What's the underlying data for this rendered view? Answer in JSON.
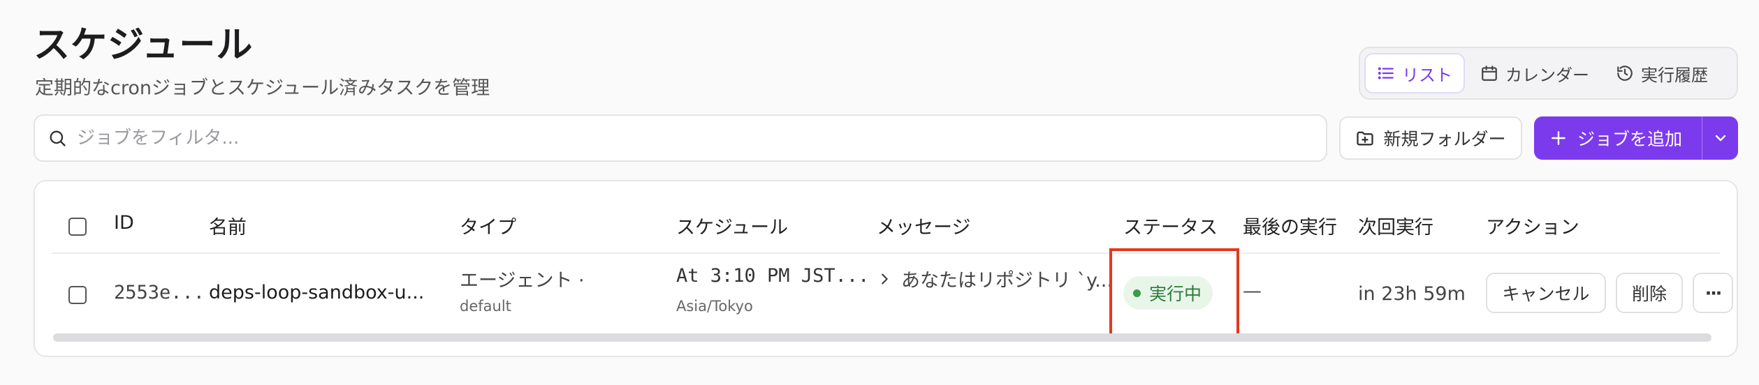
{
  "page": {
    "title": "スケジュール",
    "subtitle": "定期的なcronジョブとスケジュール済みタスクを管理"
  },
  "view_switch": {
    "list": "リスト",
    "calendar": "カレンダー",
    "history": "実行履歴",
    "active": "list"
  },
  "search": {
    "placeholder": "ジョブをフィルタ..."
  },
  "toolbar": {
    "new_folder": "新規フォルダー",
    "add_job": "ジョブを追加"
  },
  "table": {
    "headers": {
      "id": "ID",
      "name": "名前",
      "type": "タイプ",
      "schedule": "スケジュール",
      "message": "メッセージ",
      "status": "ステータス",
      "last_run": "最後の実行",
      "next_run": "次回実行",
      "actions": "アクション"
    },
    "rows": [
      {
        "id": "2553e...",
        "name": "deps-loop-sandbox-u...",
        "type": "エージェント ·",
        "type_sub": "default",
        "schedule": "At 3:10 PM JST...",
        "schedule_sub": "Asia/Tokyo",
        "message": "あなたはリポジトリ `y...",
        "status": "実行中",
        "last_run": "—",
        "next_run": "in 23h 59m",
        "cancel": "キャンセル",
        "delete": "削除",
        "more": "···"
      }
    ]
  },
  "colors": {
    "accent": "#7c3aed",
    "status_bg": "#e8f6ea",
    "status_fg": "#2f7a3a",
    "highlight": "#e0391f"
  }
}
